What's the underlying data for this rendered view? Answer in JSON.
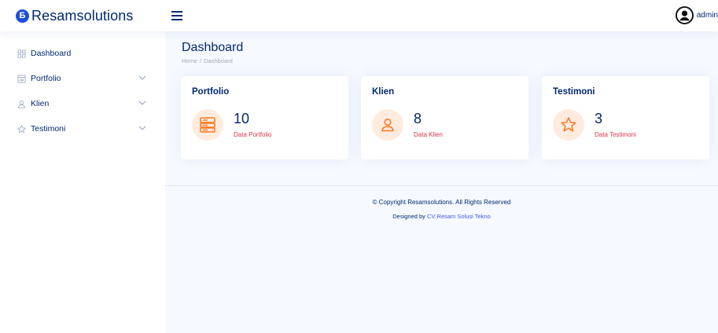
{
  "header": {
    "logo_letter": "Б",
    "brand": "Resamsolutions",
    "user_name": "admin",
    "brand_color": "#1d4ed8"
  },
  "sidebar": {
    "items": [
      {
        "label": "Dashboard",
        "icon": "grid-icon",
        "expandable": false
      },
      {
        "label": "Portfolio",
        "icon": "layout-list-icon",
        "expandable": true
      },
      {
        "label": "Klien",
        "icon": "person-icon",
        "expandable": true
      },
      {
        "label": "Testimoni",
        "icon": "star-icon",
        "expandable": true
      }
    ]
  },
  "page": {
    "title": "Dashboard",
    "breadcrumb": [
      "Home",
      "Dashboard"
    ]
  },
  "cards": [
    {
      "title": "Portfolio",
      "value": "10",
      "sub": "Data Portfolio",
      "icon": "server-icon"
    },
    {
      "title": "Klien",
      "value": "8",
      "sub": "Data Klien",
      "icon": "person-icon"
    },
    {
      "title": "Testimoni",
      "value": "3",
      "sub": "Data Testimoni",
      "icon": "star-icon"
    }
  ],
  "footer": {
    "copyright": "© Copyright Resamsolutions. All Rights Reserved",
    "designed_by_prefix": "Designed by",
    "designer": "CV Resam Solusi Tekno"
  },
  "colors": {
    "primary_text": "#012970",
    "accent_orange": "#ff771d",
    "icon_bg": "#ffecdf",
    "sub_red": "#dc3545",
    "link": "#4154f1"
  }
}
